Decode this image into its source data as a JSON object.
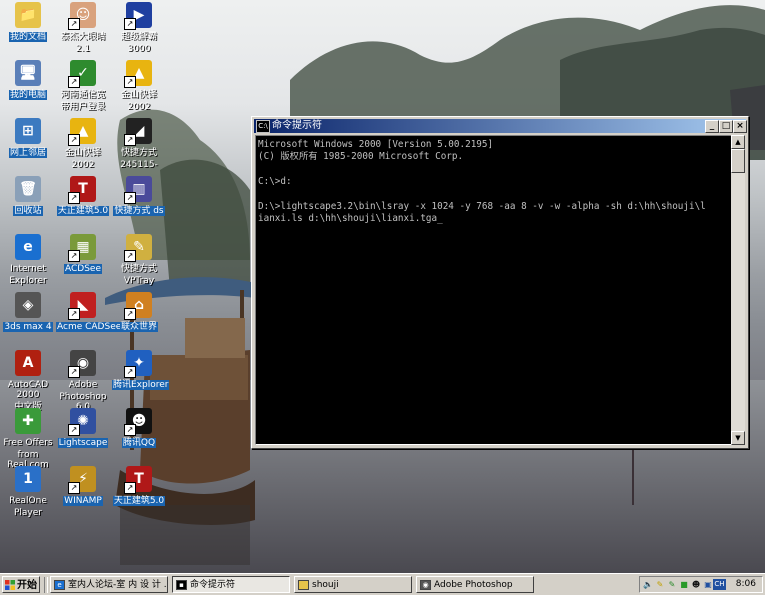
{
  "desktop": {
    "icons": [
      {
        "id": "my-documents",
        "label": "我的文档",
        "icon": "folder-docs-icon",
        "color": "#e6c34a",
        "glyph": "📁",
        "shortcut": false,
        "style": "sel"
      },
      {
        "id": "taijie-eyes",
        "label": "泰杰大眼睛\n2.1",
        "icon": "baby-photo-icon",
        "color": "#d9a27d",
        "glyph": "☺",
        "shortcut": true,
        "style": "multi"
      },
      {
        "id": "super-decoder",
        "label": "超级解霸\n3000",
        "icon": "media-player-icon",
        "color": "#1f3fa0",
        "glyph": "▶",
        "shortcut": true,
        "style": "multi"
      },
      {
        "id": "my-computer",
        "label": "我的电脑",
        "icon": "computer-icon",
        "color": "#5a7fb8",
        "glyph": "🖥",
        "shortcut": false,
        "style": "sel"
      },
      {
        "id": "henan-broadband",
        "label": "河南通信宽\n带用户登录",
        "icon": "network-login-icon",
        "color": "#2e8b2e",
        "glyph": "✓",
        "shortcut": true,
        "style": "multi"
      },
      {
        "id": "kingsoft-translate-1",
        "label": "金山快译\n2002",
        "icon": "kingsoft-icon",
        "color": "#e8b410",
        "glyph": "▲",
        "shortcut": true,
        "style": "multi"
      },
      {
        "id": "network-places",
        "label": "网上邻居",
        "icon": "network-icon",
        "color": "#3c7ac0",
        "glyph": "⊞",
        "shortcut": false,
        "style": "sel"
      },
      {
        "id": "kingsoft-translate-2",
        "label": "金山快译\n2002",
        "icon": "kingsoft-icon",
        "color": "#e8b410",
        "glyph": "▲",
        "shortcut": true,
        "style": "multi"
      },
      {
        "id": "shortcut-245115",
        "label": "快捷方式\n245115-",
        "icon": "shortcut-app-icon",
        "color": "#222222",
        "glyph": "◢",
        "shortcut": true,
        "style": "multi"
      },
      {
        "id": "recycle-bin",
        "label": "回收站",
        "icon": "recycle-bin-icon",
        "color": "#8aa0b8",
        "glyph": "🗑",
        "shortcut": false,
        "style": "sel"
      },
      {
        "id": "tianzheng-1",
        "label": "天正建筑5.0",
        "icon": "tianzheng-icon",
        "color": "#b01818",
        "glyph": "T",
        "shortcut": true,
        "style": "sel"
      },
      {
        "id": "shortcut-ds",
        "label": "快捷方式 ds",
        "icon": "chart-app-icon",
        "color": "#4a4a9a",
        "glyph": "▥",
        "shortcut": true,
        "style": "sel"
      },
      {
        "id": "internet-explorer",
        "label": "Internet\nExplorer",
        "icon": "internet-explorer-icon",
        "color": "#1a6fd0",
        "glyph": "e",
        "shortcut": false,
        "style": "multi"
      },
      {
        "id": "acdsee",
        "label": "ACDSee",
        "icon": "acdsee-icon",
        "color": "#7a9a3a",
        "glyph": "▦",
        "shortcut": true,
        "style": "sel"
      },
      {
        "id": "shortcut-vptray",
        "label": "快捷方式\nVPTray",
        "icon": "vptray-icon",
        "color": "#d0b040",
        "glyph": "✎",
        "shortcut": true,
        "style": "multi"
      },
      {
        "id": "3dsmax",
        "label": "3ds max 4",
        "icon": "3dsmax-icon",
        "color": "#555555",
        "glyph": "◈",
        "shortcut": false,
        "style": "sel"
      },
      {
        "id": "acme-cadsee",
        "label": "Acme CADSee",
        "icon": "cadsee-icon",
        "color": "#c02020",
        "glyph": "◣",
        "shortcut": true,
        "style": "sel"
      },
      {
        "id": "lianzhong",
        "label": "联众世界",
        "icon": "lianzhong-icon",
        "color": "#d08020",
        "glyph": "⌂",
        "shortcut": true,
        "style": "sel"
      },
      {
        "id": "autocad",
        "label": "AutoCAD 2000\n中文版",
        "icon": "autocad-icon",
        "color": "#b02010",
        "glyph": "A",
        "shortcut": false,
        "style": "multi"
      },
      {
        "id": "photoshop",
        "label": "Adobe\nPhotoshop 6.0",
        "icon": "photoshop-eye-icon",
        "color": "#444444",
        "glyph": "◉",
        "shortcut": true,
        "style": "multi"
      },
      {
        "id": "tencent-explorer",
        "label": "腾讯Explorer",
        "icon": "tencent-explorer-icon",
        "color": "#2060c0",
        "glyph": "✦",
        "shortcut": true,
        "style": "sel"
      },
      {
        "id": "free-offers",
        "label": "Free Offers\nfrom Real.com",
        "icon": "gift-icon",
        "color": "#3a9a3a",
        "glyph": "✚",
        "shortcut": false,
        "style": "multi"
      },
      {
        "id": "lightscape",
        "label": "Lightscape",
        "icon": "lightscape-icon",
        "color": "#3050a0",
        "glyph": "✺",
        "shortcut": true,
        "style": "sel"
      },
      {
        "id": "tencent-qq",
        "label": "腾讯QQ",
        "icon": "qq-penguin-icon",
        "color": "#111111",
        "glyph": "☻",
        "shortcut": true,
        "style": "sel"
      },
      {
        "id": "realone",
        "label": "RealOne\nPlayer",
        "icon": "realone-icon",
        "color": "#2a70c8",
        "glyph": "1",
        "shortcut": false,
        "style": "multi"
      },
      {
        "id": "winamp",
        "label": "WINAMP",
        "icon": "winamp-icon",
        "color": "#c09020",
        "glyph": "⚡",
        "shortcut": true,
        "style": "sel"
      },
      {
        "id": "tianzheng-2",
        "label": "天正建筑5.0",
        "icon": "tianzheng-icon",
        "color": "#b01818",
        "glyph": "T",
        "shortcut": true,
        "style": "sel"
      }
    ]
  },
  "cmd_window": {
    "title": "命令提示符",
    "title_icon": "C:\\",
    "lines": [
      "Microsoft Windows 2000 [Version 5.00.2195]",
      "(C) 版权所有 1985-2000 Microsoft Corp.",
      "",
      "C:\\>d:",
      "",
      "D:\\>lightscape3.2\\bin\\lsray -x 1024 -y 768 -aa 8 -v -w -alpha -sh d:\\hh\\shouji\\l",
      "ianxi.ls d:\\hh\\shouji\\lianxi.tga_"
    ],
    "buttons": {
      "minimize": "_",
      "maximize": "□",
      "close": "×"
    },
    "scroll": {
      "up": "▲",
      "down": "▼"
    }
  },
  "taskbar": {
    "start_label": "开始",
    "tasks": [
      {
        "label": "室内人论坛-室 内 设 计 ...",
        "icon": "ie-task-icon",
        "color": "#1a6fd0",
        "glyph": "e",
        "active": false
      },
      {
        "label": "命令提示符",
        "icon": "cmd-task-icon",
        "color": "#000000",
        "glyph": "▪",
        "active": true
      },
      {
        "label": "shouji",
        "icon": "folder-task-icon",
        "color": "#e6c34a",
        "glyph": "",
        "active": false
      },
      {
        "label": "Adobe Photoshop",
        "icon": "photoshop-task-icon",
        "color": "#555555",
        "glyph": "◉",
        "active": false
      }
    ],
    "tray_icons": [
      {
        "icon": "volume-icon",
        "glyph": "🔈",
        "color": "#333333"
      },
      {
        "icon": "pen-icon",
        "glyph": "✎",
        "color": "#c0a000"
      },
      {
        "icon": "pen-icon-2",
        "glyph": "✎",
        "color": "#2a8a2a"
      },
      {
        "icon": "green-app-icon",
        "glyph": "■",
        "color": "#2a9a2a"
      },
      {
        "icon": "qq-tray-icon",
        "glyph": "☻",
        "color": "#111111"
      },
      {
        "icon": "monitor-icon",
        "glyph": "▣",
        "color": "#2050a0"
      }
    ],
    "ime": "CH",
    "clock": "8:06"
  }
}
